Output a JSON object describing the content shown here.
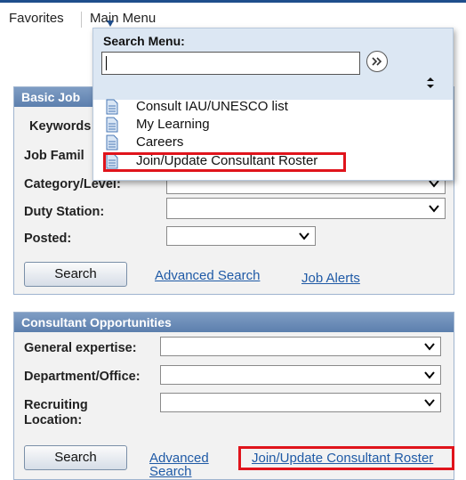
{
  "topbar": {
    "favorites": "Favorites",
    "main_menu": "Main Menu"
  },
  "search_menu": {
    "title": "Search Menu:",
    "input_value": "",
    "items": [
      "Consult IAU/UNESCO list",
      "My Learning",
      "Careers",
      "Join/Update Consultant Roster"
    ],
    "highlighted_item": "Join/Update Consultant Roster"
  },
  "basic_job": {
    "header": "Basic Job",
    "keywords_label": "Keywords",
    "job_family_label": "Job Famil",
    "category_label": "Category/Level:",
    "duty_station_label": "Duty Station:",
    "posted_label": "Posted:",
    "search_button": "Search",
    "advanced_search_link": "Advanced Search",
    "job_alerts_link": "Job Alerts"
  },
  "consultant": {
    "header": "Consultant Opportunities",
    "expertise_label": "General expertise:",
    "department_label": "Department/Office:",
    "recruiting_label_1": "Recruiting",
    "recruiting_label_2": "Location:",
    "search_button": "Search",
    "advanced_link_1": "Advanced",
    "advanced_link_2": "Search",
    "roster_link": "Join/Update Consultant Roster"
  },
  "colors": {
    "highlight": "#e0141c",
    "link": "#1f5aa6",
    "panel_header": "#6a8ab7",
    "topbar_border": "#1f4e8c"
  }
}
